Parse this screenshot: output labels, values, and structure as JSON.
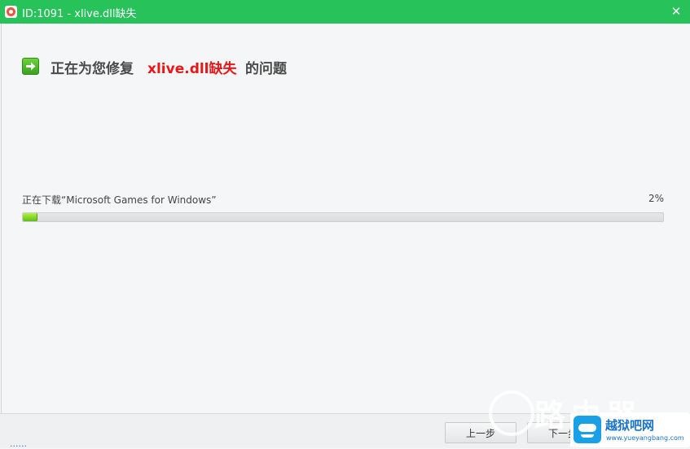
{
  "window": {
    "title": "ID:1091 - xlive.dll缺失",
    "close_glyph": "✕"
  },
  "heading": {
    "prefix": "正在为您修复",
    "highlight": "xlive.dll缺失",
    "suffix": "的问题",
    "highlight_color": "#e81818"
  },
  "progress": {
    "label": "正在下载“Microsoft Games for Windows”",
    "percent_text": "2%",
    "value": 0.02
  },
  "footer": {
    "prev_label": "上一步",
    "next_label": "下一步",
    "link_text": "......"
  },
  "watermark": {
    "chars": "路由器"
  },
  "brand": {
    "name": "越狱吧网",
    "url": "www.yueyangbang.com"
  },
  "colors": {
    "titlebar": "#27c35a",
    "accent_green": "#5fbf14",
    "text": "#4a4a4a",
    "brand_blue": "#1a73c9"
  },
  "icons": {
    "app": "app-lifebuoy-icon",
    "heading": "green-arrow-icon",
    "close": "close-icon"
  }
}
